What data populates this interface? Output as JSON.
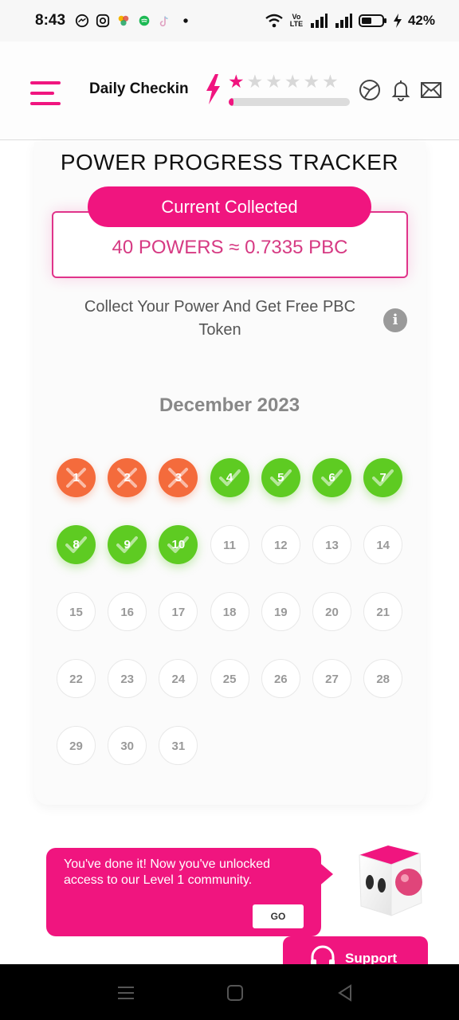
{
  "status_bar": {
    "time": "8:43",
    "battery": "42%",
    "network": "Vo LTE"
  },
  "header": {
    "title": "Daily Checkin",
    "rating_stars_filled": 1,
    "rating_stars_total": 6,
    "progress_fraction": 0.04
  },
  "tracker": {
    "title": "POWER PROGRESS TRACKER",
    "collected_label": "Current Collected",
    "collected_value": "40 POWERS ≈ 0.7335 PBC",
    "description": "Collect Your Power And Get Free PBC Token",
    "month": "December 2023"
  },
  "calendar": {
    "days": [
      {
        "n": "1",
        "status": "missed"
      },
      {
        "n": "2",
        "status": "missed"
      },
      {
        "n": "3",
        "status": "missed"
      },
      {
        "n": "4",
        "status": "done"
      },
      {
        "n": "5",
        "status": "done"
      },
      {
        "n": "6",
        "status": "done"
      },
      {
        "n": "7",
        "status": "done"
      },
      {
        "n": "8",
        "status": "done"
      },
      {
        "n": "9",
        "status": "done"
      },
      {
        "n": "10",
        "status": "done"
      },
      {
        "n": "11",
        "status": "pending"
      },
      {
        "n": "12",
        "status": "pending"
      },
      {
        "n": "13",
        "status": "pending"
      },
      {
        "n": "14",
        "status": "pending"
      },
      {
        "n": "15",
        "status": "pending"
      },
      {
        "n": "16",
        "status": "pending"
      },
      {
        "n": "17",
        "status": "pending"
      },
      {
        "n": "18",
        "status": "pending"
      },
      {
        "n": "19",
        "status": "pending"
      },
      {
        "n": "20",
        "status": "pending"
      },
      {
        "n": "21",
        "status": "pending"
      },
      {
        "n": "22",
        "status": "pending"
      },
      {
        "n": "23",
        "status": "pending"
      },
      {
        "n": "24",
        "status": "pending"
      },
      {
        "n": "25",
        "status": "pending"
      },
      {
        "n": "26",
        "status": "pending"
      },
      {
        "n": "27",
        "status": "pending"
      },
      {
        "n": "28",
        "status": "pending"
      },
      {
        "n": "29",
        "status": "pending"
      },
      {
        "n": "30",
        "status": "pending"
      },
      {
        "n": "31",
        "status": "pending"
      }
    ]
  },
  "toast": {
    "message": "You've done it! Now you've unlocked access to our Level 1 community.",
    "button": "GO"
  },
  "support": {
    "label": "Support"
  },
  "colors": {
    "accent": "#f0157f",
    "missed": "#f46b3c",
    "done": "#5ecb22"
  },
  "icons": {
    "menu": "menu-icon",
    "bolt": "lightning-bolt-icon",
    "wallet": "wallet-icon",
    "bell": "bell-icon",
    "mail": "mail-icon",
    "info": "info-icon",
    "headset": "headset-icon"
  }
}
